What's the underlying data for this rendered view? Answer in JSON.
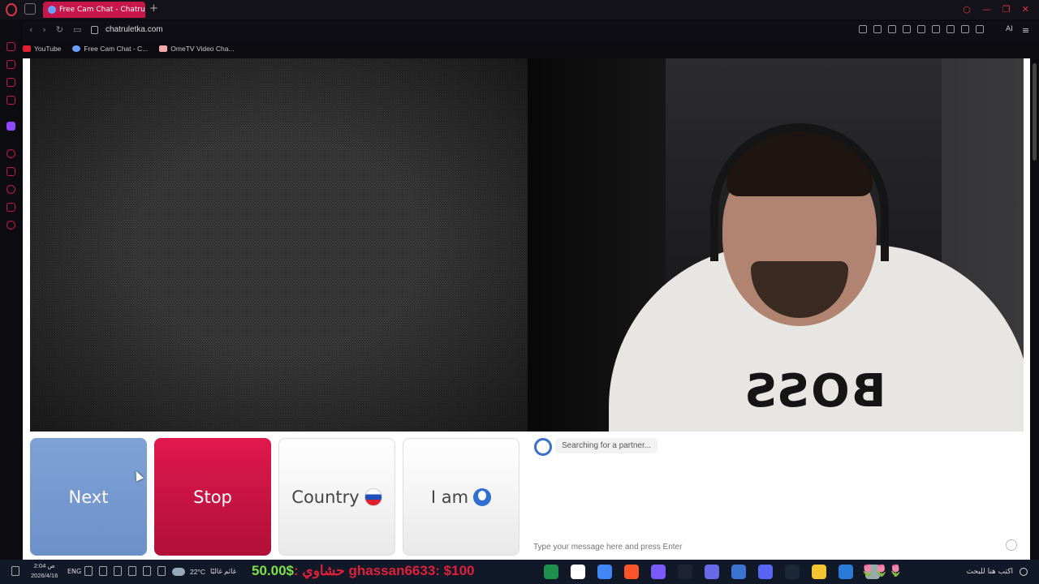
{
  "browser": {
    "active_tab_title": "Free Cam Chat - Chatru",
    "new_tab_label": "+",
    "url": "chatruletka.com",
    "ai_label": "AI",
    "bookmarks": [
      {
        "label": "YouTube",
        "color": "#e1202f"
      },
      {
        "label": "Free Cam Chat - C...",
        "color": "#6aa0ff"
      },
      {
        "label": "OmeTV Video Cha...",
        "color": "#f0a8a8"
      }
    ]
  },
  "chat_app": {
    "buttons": {
      "next": "Next",
      "stop": "Stop",
      "country": "Country",
      "i_am": "I am"
    },
    "status": "Searching for a partner...",
    "input_placeholder": "Type your message here and press Enter",
    "shirt_text": "BOSS"
  },
  "taskbar": {
    "time": "2:04 ص",
    "date": "2026/4/16",
    "language": "ENG",
    "temperature": "22°C",
    "weather_text": "غائم غالبًا",
    "ticker_amount": "50.00$",
    "ticker_sep": ": ",
    "ticker_name_ar": "حشاوي",
    "ticker_user": "ghassan6633",
    "ticker_user_amount": ": $100",
    "search_placeholder": "اكتب هنا للبحث",
    "tulips": "🌷🌷🌷",
    "app_colors": [
      "#1f8f4e",
      "#ffffff",
      "#4285f4",
      "#fb542b",
      "#7a5af8",
      "#1e2333",
      "#6a6ae8",
      "#3a73d0",
      "#5865f2",
      "#1b2838",
      "#f4c430",
      "#2a7ad8",
      "#9aa"
    ]
  },
  "colors": {
    "accent": "#c8154b",
    "next_btn": "#7fa2d6",
    "stop_btn": "#e0184e"
  }
}
